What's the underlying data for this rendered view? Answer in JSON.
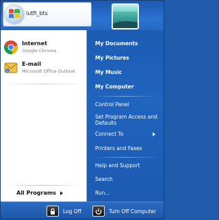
{
  "user": {
    "name": "lutfi_bts"
  },
  "pinned": [
    {
      "title": "Internet",
      "subtitle": "Google Chrome",
      "icon": "chrome-icon"
    },
    {
      "title": "E-mail",
      "subtitle": "Microsoft Office Outlook",
      "icon": "outlook-icon"
    }
  ],
  "all_programs": {
    "label": "All Programs",
    "icon": "arrow-right-icon"
  },
  "right_menu": {
    "documents": "My Documents",
    "pictures": "My Pictures",
    "music": "My Music",
    "computer": "My Computer",
    "control_panel": "Control Panel",
    "set_program_line1": "Set Program Access and",
    "set_program_line2": "Defaults",
    "connect_to": "Connect To",
    "printers": "Printers and Faxes",
    "help": "Help and Support",
    "search": "Search",
    "run": "Run..."
  },
  "footer": {
    "log_off": "Log Off",
    "turn_off": "Turn Off Computer"
  },
  "colors": {
    "menu_blue": "#1e5aa8",
    "panel_white": "#ffffff"
  }
}
